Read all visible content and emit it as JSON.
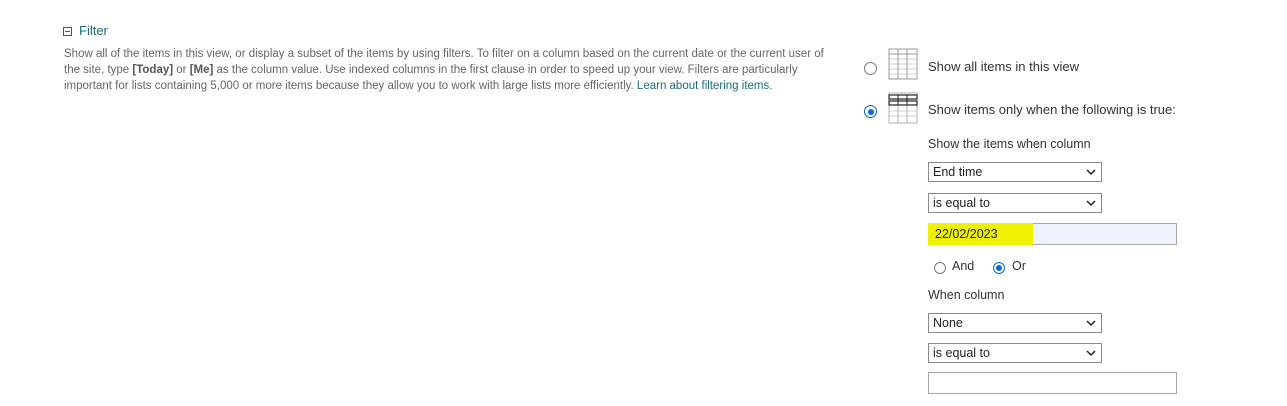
{
  "section": {
    "title": "Filter",
    "description_parts": {
      "p1": "Show all of the items in this view, or display a subset of the items by using filters. To filter on a column based on the current date or the current user of the site, type ",
      "today": "[Today]",
      "p2": " or ",
      "me": "[Me]",
      "p3": " as the column value. Use indexed columns in the first clause in order to speed up your view. Filters are particularly important for lists containing 5,000 or more items because they allow you to work with large lists more efficiently. ",
      "link": "Learn about filtering items."
    }
  },
  "options": {
    "show_all": {
      "label": "Show all items in this view",
      "checked": false
    },
    "show_filtered": {
      "label": "Show items only when the following is true:",
      "checked": true
    }
  },
  "clause1": {
    "label": "Show the items when column",
    "column": "End time",
    "operator": "is equal to",
    "value": "22/02/2023",
    "highlight_color": "#eef200"
  },
  "logic": {
    "and_label": "And",
    "or_label": "Or",
    "selected": "Or"
  },
  "clause2": {
    "label": "When column",
    "column": "None",
    "operator": "is equal to",
    "value": ""
  },
  "colors": {
    "link": "#1b6b7b",
    "radio_selected": "#0b66d6",
    "text": "#333333"
  }
}
